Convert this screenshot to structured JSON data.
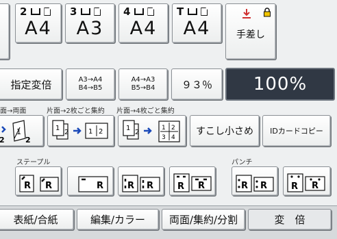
{
  "trays": [
    {
      "num": "2",
      "size": "A4"
    },
    {
      "num": "3",
      "size": "A3"
    },
    {
      "num": "4",
      "size": "A4"
    },
    {
      "num": "T",
      "size": "A4"
    }
  ],
  "bypass": {
    "label": "手差し"
  },
  "ratio": {
    "custom_label": "指定変倍",
    "a3_a4_line1": "A3→A4",
    "a3_a4_line2": "B4→B5",
    "a4_a3_line1": "A4→A3",
    "a4_a3_line2": "B5→B4",
    "pct93": "９３％",
    "current": "100%"
  },
  "sections": {
    "duplex_label": "面→両面",
    "combine2_label": "片面→2枚ごと集約",
    "combine4_label": "片面→4枚ごと集約",
    "staple_label": "ステープル",
    "punch_label": "パンチ"
  },
  "functions": {
    "reduce_slightly": "すこし小さめ",
    "id_copy": "IDカードコピー"
  },
  "tabs": [
    "表紙/合紙",
    "編集/カラー",
    "両面/集約/分割",
    "変　倍"
  ]
}
